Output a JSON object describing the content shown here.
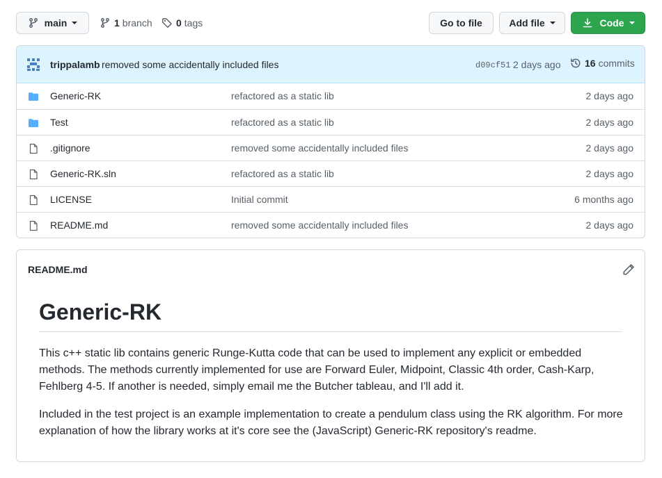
{
  "toolbar": {
    "branch_select": "main",
    "branches_count": "1",
    "branches_label": "branch",
    "tags_count": "0",
    "tags_label": "tags",
    "go_to_file": "Go to file",
    "add_file": "Add file",
    "code": "Code"
  },
  "commit": {
    "author": "trippalamb",
    "message": "removed some accidentally included files",
    "sha": "d09cf51",
    "age": "2 days ago",
    "commits_count": "16",
    "commits_label": "commits"
  },
  "files": [
    {
      "name": "Generic-RK",
      "type": "folder",
      "message": "refactored as a static lib",
      "age": "2 days ago"
    },
    {
      "name": "Test",
      "type": "folder",
      "message": "refactored as a static lib",
      "age": "2 days ago"
    },
    {
      "name": ".gitignore",
      "type": "file",
      "message": "removed some accidentally included files",
      "age": "2 days ago"
    },
    {
      "name": "Generic-RK.sln",
      "type": "file",
      "message": "refactored as a static lib",
      "age": "2 days ago"
    },
    {
      "name": "LICENSE",
      "type": "file",
      "message": "Initial commit",
      "age": "6 months ago"
    },
    {
      "name": "README.md",
      "type": "file",
      "message": "removed some accidentally included files",
      "age": "2 days ago"
    }
  ],
  "readme": {
    "filename": "README.md",
    "heading": "Generic-RK",
    "paragraphs": [
      "This c++ static lib contains generic Runge-Kutta code that can be used to implement any explicit or embedded methods. The methods currently implemented for use are Forward Euler, Midpoint, Classic 4th order, Cash-Karp, Fehlberg 4-5. If another is needed, simply email me the Butcher tableau, and I'll add it.",
      "Included in the test project is an example implementation to create a pendulum class using the RK algorithm. For more explanation of how the library works at it's core see the (JavaScript) Generic-RK repository's readme."
    ]
  },
  "icons": {
    "branch": "git-branch-icon",
    "tag": "tag-icon",
    "download": "download-icon",
    "history": "history-icon",
    "folder": "folder-icon",
    "file": "file-icon",
    "edit": "pencil-icon"
  },
  "colors": {
    "accent_green": "#2da44e",
    "commit_bar_bg": "#ddf4ff",
    "folder_blue": "#54aeff",
    "border": "#d0d7de"
  }
}
